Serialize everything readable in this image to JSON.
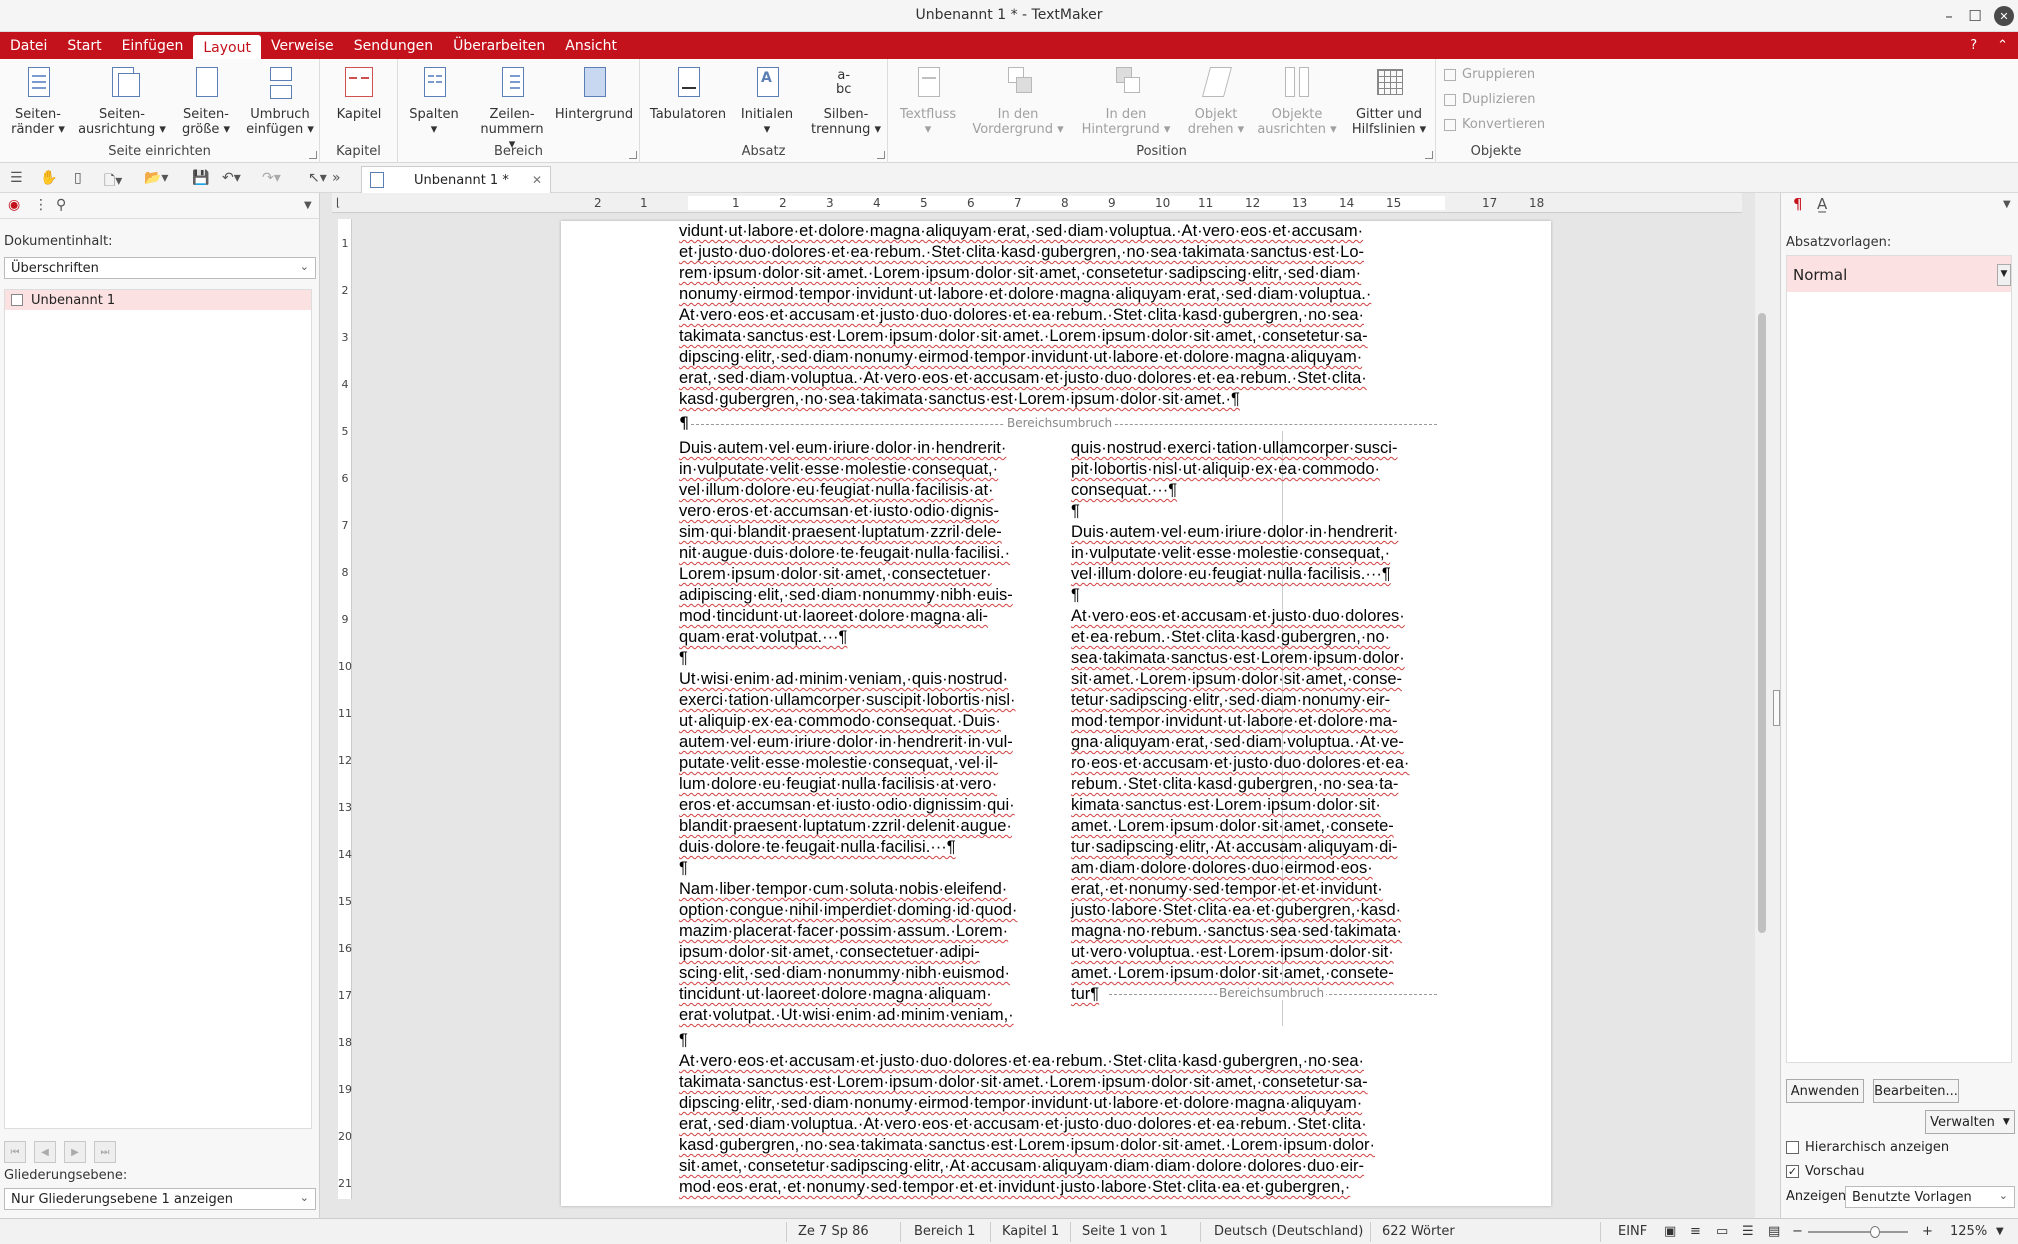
{
  "window": {
    "title": "Unbenannt 1 * - TextMaker"
  },
  "menu": [
    "Datei",
    "Start",
    "Einfügen",
    "Layout",
    "Verweise",
    "Sendungen",
    "Überarbeiten",
    "Ansicht"
  ],
  "ribbon": {
    "groups": {
      "seite": "Seite einrichten",
      "kapitel": "Kapitel",
      "bereich": "Bereich",
      "absatz": "Absatz",
      "position": "Position",
      "objekte": "Objekte"
    },
    "buttons": {
      "seitenraender": [
        "Seiten-",
        "ränder ▾"
      ],
      "seitenausrichtung": [
        "Seiten-",
        "ausrichtung ▾"
      ],
      "seitengroesse": [
        "Seiten-",
        "größe ▾"
      ],
      "umbruch": [
        "Umbruch",
        "einfügen ▾"
      ],
      "kapitel": [
        "Kapitel",
        ""
      ],
      "spalten": [
        "Spalten",
        "▾"
      ],
      "zeilennummern": [
        "Zeilen-",
        "nummern ▾"
      ],
      "hintergrund": [
        "Hintergrund",
        ""
      ],
      "tabulatoren": [
        "Tabulatoren",
        ""
      ],
      "initialen": [
        "Initialen",
        "▾"
      ],
      "silbentrennung": [
        "Silben-",
        "trennung ▾"
      ],
      "textfluss": [
        "Textfluss",
        "▾"
      ],
      "vordergrund": [
        "In den",
        "Vordergrund ▾"
      ],
      "hintergrund2": [
        "In den",
        "Hintergrund ▾"
      ],
      "drehen": [
        "Objekt",
        "drehen ▾"
      ],
      "ausrichten": [
        "Objekte",
        "ausrichten ▾"
      ],
      "gitter": [
        "Gitter und",
        "Hilfslinien ▾"
      ]
    },
    "small": {
      "gruppieren": "Gruppieren",
      "duplizieren": "Duplizieren",
      "konvertieren": "Konvertieren"
    }
  },
  "tab": {
    "name": "Unbenannt 1 *"
  },
  "left_panel": {
    "content_label": "Dokumentinhalt:",
    "content_select": "Überschriften",
    "tree_item": "Unbenannt 1",
    "level_label": "Gliederungsebene:",
    "level_select": "Nur Gliederungsebene 1 anzeigen"
  },
  "ruler_h": [
    "2",
    "1",
    "1",
    "2",
    "3",
    "4",
    "5",
    "6",
    "7",
    "8",
    "9",
    "10",
    "11",
    "12",
    "13",
    "14",
    "15",
    "17",
    "18"
  ],
  "ruler_v": [
    "1",
    "2",
    "3",
    "4",
    "5",
    "6",
    "7",
    "8",
    "9",
    "10",
    "11",
    "12",
    "13",
    "14",
    "15",
    "16",
    "17",
    "18",
    "19",
    "20",
    "21"
  ],
  "document": {
    "top_lines": [
      "vidunt·ut·labore·et·dolore·magna·aliquyam·erat,·sed·diam·voluptua.·At·vero·eos·et·accusam·",
      "et·justo·duo·dolores·et·ea·rebum.·Stet·clita·kasd·gubergren,·no·sea·takimata·sanctus·est·Lo-",
      "rem·ipsum·dolor·sit·amet.·Lorem·ipsum·dolor·sit·amet,·consetetur·sadipscing·elitr,·sed·diam·",
      "nonumy·eirmod·tempor·invidunt·ut·labore·et·dolore·magna·aliquyam·erat,·sed·diam·voluptua.·",
      "At·vero·eos·et·accusam·et·justo·duo·dolores·et·ea·rebum.·Stet·clita·kasd·gubergren,·no·sea·",
      "takimata·sanctus·est·Lorem·ipsum·dolor·sit·amet.·Lorem·ipsum·dolor·sit·amet,·consetetur·sa-",
      "dipscing·elitr,·sed·diam·nonumy·eirmod·tempor·invidunt·ut·labore·et·dolore·magna·aliquyam·",
      "erat,·sed·diam·voluptua.·At·vero·eos·et·accusam·et·justo·duo·dolores·et·ea·rebum.·Stet·clita·",
      "kasd·gubergren,·no·sea·takimata·sanctus·est·Lorem·ipsum·dolor·sit·amet.·¶"
    ],
    "section_break_label": "Bereichsumbruch",
    "pilcrow": "¶",
    "col1_lines": [
      "Duis·autem·vel·eum·iriure·dolor·in·hendrerit·",
      "in·vulputate·velit·esse·molestie·consequat,·",
      "vel·illum·dolore·eu·feugiat·nulla·facilisis·at·",
      "vero·eros·et·accumsan·et·iusto·odio·dignis-",
      "sim·qui·blandit·praesent·luptatum·zzril·dele-",
      "nit·augue·duis·dolore·te·feugait·nulla·facilisi.·",
      "Lorem·ipsum·dolor·sit·amet,·consectetuer·",
      "adipiscing·elit,·sed·diam·nonummy·nibh·euis-",
      "mod·tincidunt·ut·laoreet·dolore·magna·ali-",
      "quam·erat·volutpat.···¶",
      "¶",
      "Ut·wisi·enim·ad·minim·veniam,·quis·nostrud·",
      "exerci·tation·ullamcorper·suscipit·lobortis·nisl·",
      "ut·aliquip·ex·ea·commodo·consequat.·Duis·",
      "autem·vel·eum·iriure·dolor·in·hendrerit·in·vul-",
      "putate·velit·esse·molestie·consequat,·vel·il-",
      "lum·dolore·eu·feugiat·nulla·facilisis·at·vero·",
      "eros·et·accumsan·et·iusto·odio·dignissim·qui·",
      "blandit·praesent·luptatum·zzril·delenit·augue·",
      "duis·dolore·te·feugait·nulla·facilisi.···¶",
      "¶",
      "Nam·liber·tempor·cum·soluta·nobis·eleifend·",
      "option·congue·nihil·imperdiet·doming·id·quod·",
      "mazim·placerat·facer·possim·assum.·Lorem·",
      "ipsum·dolor·sit·amet,·consectetuer·adipi-",
      "scing·elit,·sed·diam·nonummy·nibh·euismod·",
      "tincidunt·ut·laoreet·dolore·magna·aliquam·",
      "erat·volutpat.·Ut·wisi·enim·ad·minim·veniam,·"
    ],
    "col2_lines": [
      "quis·nostrud·exerci·tation·ullamcorper·susci-",
      "pit·lobortis·nisl·ut·aliquip·ex·ea·commodo·",
      "consequat.···¶",
      "¶",
      "Duis·autem·vel·eum·iriure·dolor·in·hendrerit·",
      "in·vulputate·velit·esse·molestie·consequat,·",
      "vel·illum·dolore·eu·feugiat·nulla·facilisis.···¶",
      "¶",
      "At·vero·eos·et·accusam·et·justo·duo·dolores·",
      "et·ea·rebum.·Stet·clita·kasd·gubergren,·no·",
      "sea·takimata·sanctus·est·Lorem·ipsum·dolor·",
      "sit·amet.·Lorem·ipsum·dolor·sit·amet,·conse-",
      "tetur·sadipscing·elitr,·sed·diam·nonumy·eir-",
      "mod·tempor·invidunt·ut·labore·et·dolore·ma-",
      "gna·aliquyam·erat,·sed·diam·voluptua.·At·ve-",
      "ro·eos·et·accusam·et·justo·duo·dolores·et·ea·",
      "rebum.·Stet·clita·kasd·gubergren,·no·sea·ta-",
      "kimata·sanctus·est·Lorem·ipsum·dolor·sit·",
      "amet.·Lorem·ipsum·dolor·sit·amet,·consete-",
      "tur·sadipscing·elitr,·At·accusam·aliquyam·di-",
      "am·diam·dolore·dolores·duo·eirmod·eos·",
      "erat,·et·nonumy·sed·tempor·et·et·invidunt·",
      "justo·labore·Stet·clita·ea·et·gubergren,·kasd·",
      "magna·no·rebum.·sanctus·sea·sed·takimata·",
      "ut·vero·voluptua.·est·Lorem·ipsum·dolor·sit·",
      "amet.·Lorem·ipsum·dolor·sit·amet,·consete-",
      "tur¶"
    ],
    "bottom_lines": [
      "At·vero·eos·et·accusam·et·justo·duo·dolores·et·ea·rebum.·Stet·clita·kasd·gubergren,·no·sea·",
      "takimata·sanctus·est·Lorem·ipsum·dolor·sit·amet.·Lorem·ipsum·dolor·sit·amet,·consetetur·sa-",
      "dipscing·elitr,·sed·diam·nonumy·eirmod·tempor·invidunt·ut·labore·et·dolore·magna·aliquyam·",
      "erat,·sed·diam·voluptua.·At·vero·eos·et·accusam·et·justo·duo·dolores·et·ea·rebum.·Stet·clita·",
      "kasd·gubergren,·no·sea·takimata·sanctus·est·Lorem·ipsum·dolor·sit·amet.·Lorem·ipsum·dolor·",
      "sit·amet,·consetetur·sadipscing·elitr,·At·accusam·aliquyam·diam·diam·dolore·dolores·duo·eir-",
      "mod·eos·erat,·et·nonumy·sed·tempor·et·et·invidunt·justo·labore·Stet·clita·ea·et·gubergren,·"
    ]
  },
  "right_panel": {
    "label": "Absatzvorlagen:",
    "current_style": "Normal",
    "apply": "Anwenden",
    "edit": "Bearbeiten...",
    "manage": "Verwalten",
    "hier": "Hierarchisch anzeigen",
    "preview": "Vorschau",
    "show_label": "Anzeigen:",
    "show_select": "Benutzte Vorlagen"
  },
  "status": {
    "pos": "Ze 7 Sp 86",
    "bereich": "Bereich 1",
    "kapitel": "Kapitel 1",
    "seite": "Seite 1 von 1",
    "lang": "Deutsch (Deutschland)",
    "words": "622 Wörter",
    "mode": "EINF",
    "zoom": "125%"
  }
}
